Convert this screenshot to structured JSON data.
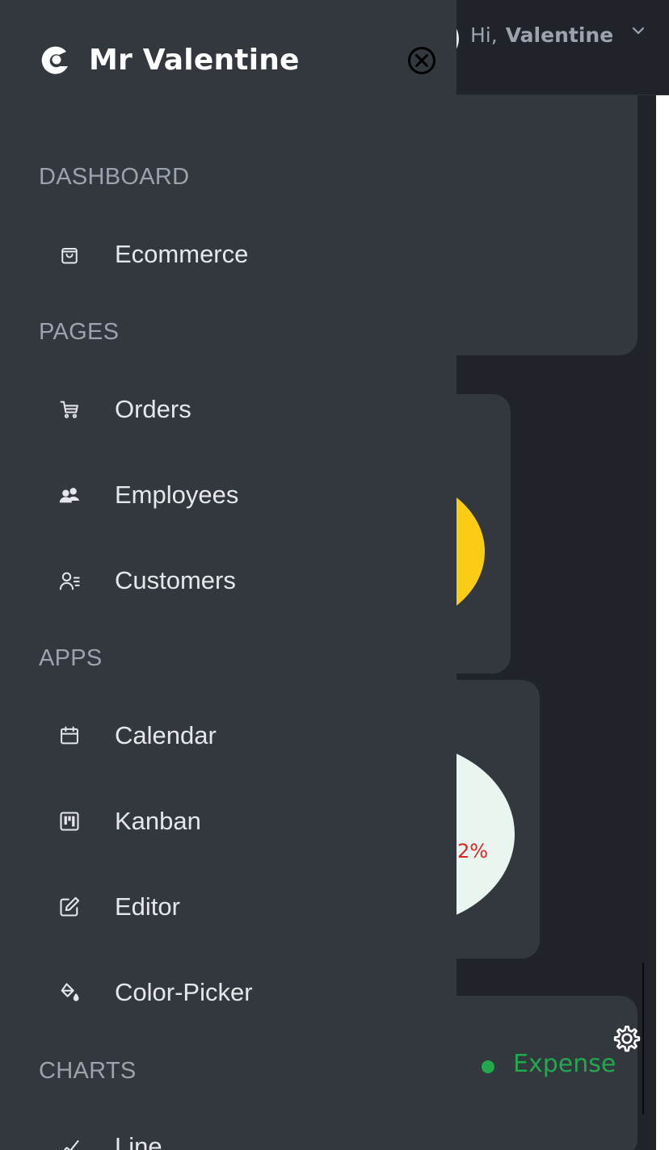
{
  "header": {
    "greeting_prefix": "Hi,",
    "user_name": "Valentine"
  },
  "sidebar": {
    "brand_name": "Mr Valentine",
    "sections": [
      {
        "title": "DASHBOARD",
        "items": [
          {
            "label": "Ecommerce",
            "icon": "shopping-bag-icon"
          }
        ]
      },
      {
        "title": "PAGES",
        "items": [
          {
            "label": "Orders",
            "icon": "cart-icon"
          },
          {
            "label": "Employees",
            "icon": "people-icon"
          },
          {
            "label": "Customers",
            "icon": "user-list-icon"
          }
        ]
      },
      {
        "title": "APPS",
        "items": [
          {
            "label": "Calendar",
            "icon": "calendar-icon"
          },
          {
            "label": "Kanban",
            "icon": "kanban-icon"
          },
          {
            "label": "Editor",
            "icon": "edit-icon"
          },
          {
            "label": "Color-Picker",
            "icon": "paint-bucket-icon"
          }
        ]
      },
      {
        "title": "CHARTS",
        "items": [
          {
            "label": "Line",
            "icon": "line-chart-icon"
          }
        ]
      }
    ]
  },
  "background": {
    "pie_label_partial": "2%",
    "legend_label": "Expense"
  },
  "colors": {
    "sidebar_bg": "#33373e",
    "page_bg": "#20232a",
    "accent_yellow": "#facc15",
    "expense_green": "#22a84e",
    "label_red": "#dc2626"
  }
}
